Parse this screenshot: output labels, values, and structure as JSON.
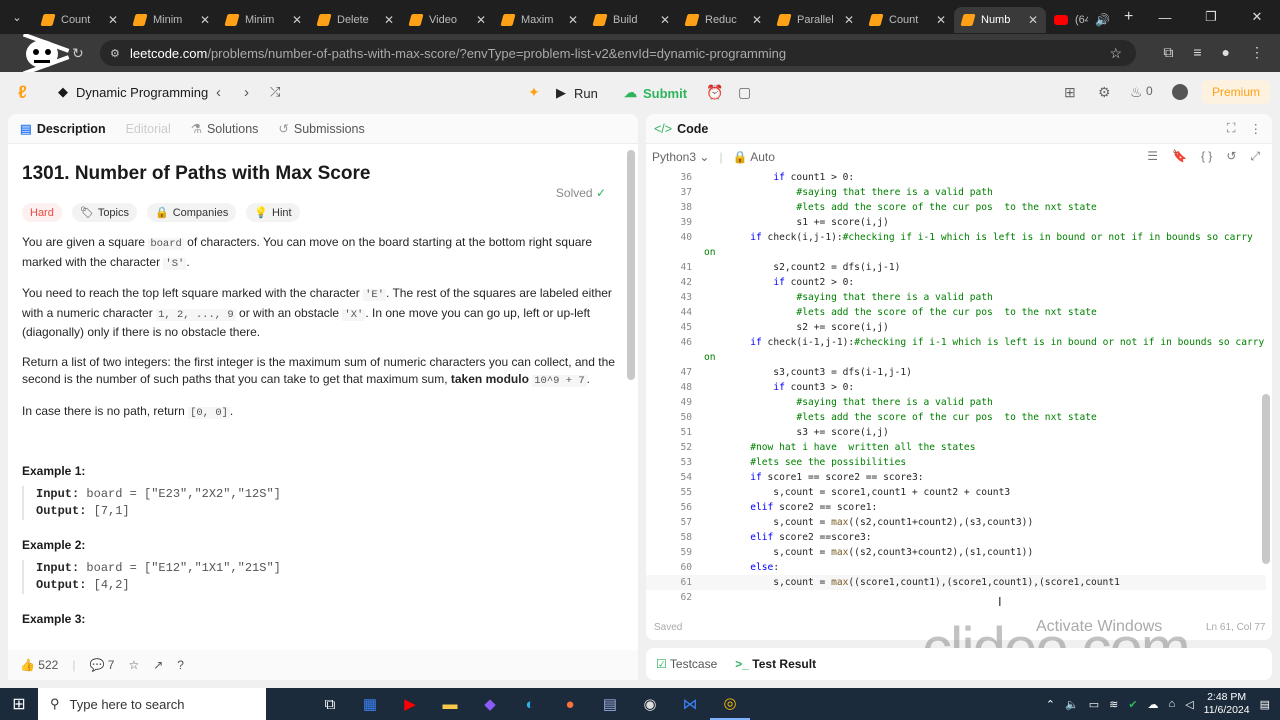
{
  "browser": {
    "tabs": [
      {
        "label": "Count"
      },
      {
        "label": "Minim"
      },
      {
        "label": "Minim"
      },
      {
        "label": "Delete"
      },
      {
        "label": "Video"
      },
      {
        "label": "Maxim"
      },
      {
        "label": "Build"
      },
      {
        "label": "Reduc"
      },
      {
        "label": "Parallel"
      },
      {
        "label": "Count"
      },
      {
        "label": "Numb"
      },
      {
        "label": "(64"
      }
    ],
    "url_domain": "leetcode.com",
    "url_path": "/problems/number-of-paths-with-max-score/?envType=problem-list-v2&envId=dynamic-programming"
  },
  "leetcode_header": {
    "list_title": "Dynamic Programming",
    "run_label": "Run",
    "submit_label": "Submit",
    "streak_count": "0",
    "premium_label": "Premium"
  },
  "left_tabs": {
    "description": "Description",
    "editorial": "Editorial",
    "solutions": "Solutions",
    "submissions": "Submissions"
  },
  "problem": {
    "title": "1301. Number of Paths with Max Score",
    "solved_label": "Solved",
    "difficulty": "Hard",
    "tag_topics": "Topics",
    "tag_companies": "Companies",
    "tag_hint": "Hint",
    "p1a": "You are given a square ",
    "p1code1": "board",
    "p1b": " of characters. You can move on the board starting at the bottom right square marked with the character ",
    "p1code2": "'S'",
    "p1c": ".",
    "p2a": "You need to reach the top left square marked with the character ",
    "p2code1": "'E'",
    "p2b": ". The rest of the squares are labeled either with a numeric character ",
    "p2code2": "1, 2, ..., 9",
    "p2c": " or with an obstacle ",
    "p2code3": "'X'",
    "p2d": ". In one move you can go up, left or up-left (diagonally) only if there is no obstacle there.",
    "p3a": "Return a list of two integers: the first integer is the maximum sum of numeric characters you can collect, and the second is the number of such paths that you can take to get that maximum sum, ",
    "p3bold": "taken modulo ",
    "p3code": "10^9 + 7",
    "p3c": ".",
    "p4a": "In case there is no path, return ",
    "p4code": "[0, 0]",
    "p4b": ".",
    "ex1_title": "Example 1:",
    "ex1_input_label": "Input:",
    "ex1_input": " board = [\"E23\",\"2X2\",\"12S\"]",
    "ex1_output_label": "Output:",
    "ex1_output": " [7,1]",
    "ex2_title": "Example 2:",
    "ex2_input_label": "Input:",
    "ex2_input": " board = [\"E12\",\"1X1\",\"21S\"]",
    "ex2_output_label": "Output:",
    "ex2_output": " [4,2]",
    "ex3_title": "Example 3:"
  },
  "left_footer": {
    "likes": "522",
    "comments": "7"
  },
  "code_panel": {
    "title": "Code",
    "language": "Python3",
    "auto_label": "Auto",
    "saved_label": "Saved",
    "position": "Ln 61, Col 77",
    "lines": [
      {
        "n": "36",
        "t": "            if count1 > 0:"
      },
      {
        "n": "37",
        "t": "                #saying that there is a valid path"
      },
      {
        "n": "38",
        "t": "                #lets add the score of the cur pos  to the nxt state"
      },
      {
        "n": "39",
        "t": "                s1 += score(i,j)"
      },
      {
        "n": "40",
        "t": "        if check(i,j-1):#checking if i-1 which is left is in bound or not if in bounds so carry on"
      },
      {
        "n": "41",
        "t": "            s2,count2 = dfs(i,j-1)"
      },
      {
        "n": "42",
        "t": "            if count2 > 0:"
      },
      {
        "n": "43",
        "t": "                #saying that there is a valid path"
      },
      {
        "n": "44",
        "t": "                #lets add the score of the cur pos  to the nxt state"
      },
      {
        "n": "45",
        "t": "                s2 += score(i,j)"
      },
      {
        "n": "46",
        "t": "        if check(i-1,j-1):#checking if i-1 which is left is in bound or not if in bounds so carry on"
      },
      {
        "n": "47",
        "t": "            s3,count3 = dfs(i-1,j-1)"
      },
      {
        "n": "48",
        "t": "            if count3 > 0:"
      },
      {
        "n": "49",
        "t": "                #saying that there is a valid path"
      },
      {
        "n": "50",
        "t": "                #lets add the score of the cur pos  to the nxt state"
      },
      {
        "n": "51",
        "t": "                s3 += score(i,j)"
      },
      {
        "n": "52",
        "t": "        #now hat i have  written all the states"
      },
      {
        "n": "53",
        "t": "        #lets see the possibilities"
      },
      {
        "n": "54",
        "t": "        if score1 == score2 == score3:"
      },
      {
        "n": "55",
        "t": "            s,count = score1,count1 + count2 + count3"
      },
      {
        "n": "56",
        "t": "        elif score2 == score1:"
      },
      {
        "n": "57",
        "t": "            s,count = max((s2,count1+count2),(s3,count3))"
      },
      {
        "n": "58",
        "t": "        elif score2 ==score3:"
      },
      {
        "n": "59",
        "t": "            s,count = max((s2,count3+count2),(s1,count1))"
      },
      {
        "n": "60",
        "t": "        else:"
      },
      {
        "n": "61",
        "t": "            s,count = max((score1,count1),(score1,count1),(score1,count1"
      },
      {
        "n": "62",
        "t": ""
      }
    ]
  },
  "bottom_panel": {
    "testcase": "Testcase",
    "test_result": "Test Result"
  },
  "overlay": {
    "activate_windows": "Activate Windows",
    "watermark": "clideo.com"
  },
  "taskbar": {
    "search_placeholder": "Type here to search",
    "time": "2:48 PM",
    "date": "11/6/2024"
  }
}
